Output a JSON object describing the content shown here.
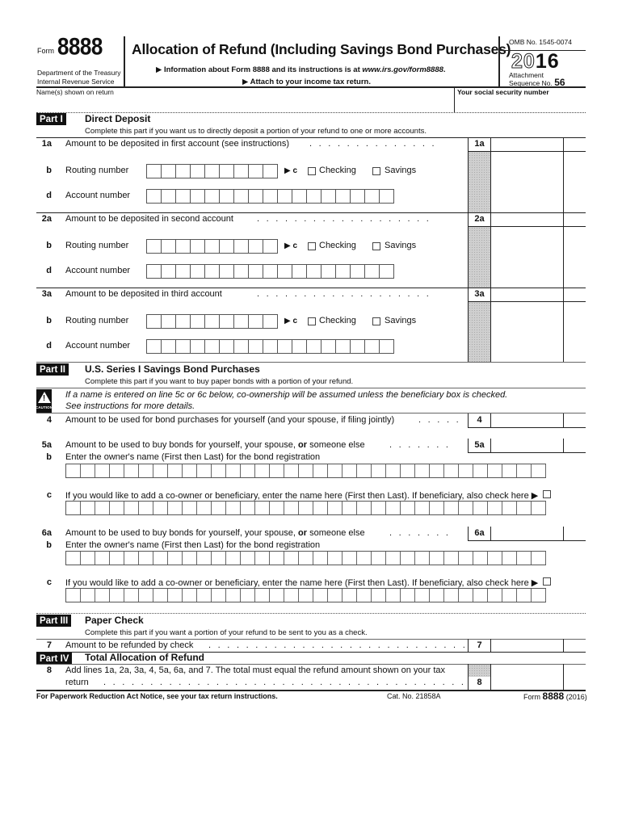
{
  "header": {
    "form_word": "Form",
    "form_number": "8888",
    "department": "Department of the Treasury",
    "agency": "Internal Revenue Service",
    "title": "Allocation of Refund (Including Savings Bond Purchases)",
    "info_prefix": "▶ Information about Form 8888 and its instructions is at ",
    "info_url": "www.irs.gov/form8888",
    "info_suffix": ".",
    "attach": "▶ Attach to your income tax return.",
    "omb": "OMB No. 1545-0074",
    "year_outline": "20",
    "year_bold": "16",
    "attachment_label": "Attachment",
    "sequence_label": "Sequence No.",
    "sequence_number": "56",
    "name_label": "Name(s) shown on return",
    "ssn_label": "Your social security number",
    "name_value": "",
    "ssn_value": ""
  },
  "part1": {
    "tag": "Part I",
    "title": "Direct Deposit",
    "instruction": "Complete this part if you want us to directly deposit a portion of your refund to one or more accounts.",
    "accounts": [
      {
        "num": "1a",
        "text": "Amount to be deposited in first account (see instructions)",
        "box": "1a",
        "amount": "",
        "cents": ""
      },
      {
        "num": "2a",
        "text": "Amount to be deposited in second account",
        "box": "2a",
        "amount": "",
        "cents": ""
      },
      {
        "num": "3a",
        "text": "Amount to be deposited in third account",
        "box": "3a",
        "amount": "",
        "cents": ""
      }
    ],
    "routing_letter": "b",
    "routing_label": "Routing number",
    "type_letter": "▶ c",
    "checking_label": "Checking",
    "savings_label": "Savings",
    "account_letter": "d",
    "account_label": "Account number",
    "routing_digits": 9,
    "account_digits": 17
  },
  "part2": {
    "tag": "Part II",
    "title": "U.S. Series I Savings Bond Purchases",
    "instruction": "Complete this part if you want to buy paper bonds with a portion of your refund.",
    "caution_label": "CAUTION",
    "caution_line1": "If a name is entered on line 5c or 6c below, co-ownership will be assumed unless the beneficiary box is checked.",
    "caution_line2": "See instructions for more details.",
    "line4": {
      "num": "4",
      "text": "Amount to be used for bond purchases for yourself (and your spouse, if filing jointly)",
      "box": "4"
    },
    "line5a": {
      "num": "5a",
      "text_pre": "Amount to be used to buy bonds for yourself, your spouse, ",
      "text_bold": "or",
      "text_post": " someone else",
      "box": "5a"
    },
    "line5b": {
      "num": "b",
      "text": "Enter the owner's name (First then Last) for the bond registration"
    },
    "line5c": {
      "num": "c",
      "text": "If you would like to add a co-owner or beneficiary, enter the name here (First then Last). If beneficiary, also check here ▶"
    },
    "line6a": {
      "num": "6a",
      "text_pre": "Amount to be used to buy bonds for yourself, your spouse, ",
      "text_bold": "or",
      "text_post": " someone else",
      "box": "6a"
    },
    "line6b": {
      "num": "b",
      "text": "Enter the owner's name (First then Last) for the bond registration"
    },
    "line6c": {
      "num": "c",
      "text": "If you would like to add a co-owner or beneficiary, enter the name here (First then Last). If beneficiary, also check here ▶"
    },
    "name_boxes": 33
  },
  "part3": {
    "tag": "Part III",
    "title": "Paper Check",
    "instruction": "Complete this part if you want a portion of your refund to be sent to you as a check.",
    "line7": {
      "num": "7",
      "text": "Amount to be refunded by check",
      "box": "7"
    }
  },
  "part4": {
    "tag": "Part IV",
    "title": "Total Allocation of Refund",
    "line8": {
      "num": "8",
      "text1": "Add lines 1a, 2a, 3a, 4, 5a, 6a, and 7. The total must equal the refund amount shown on your tax",
      "text2": "return",
      "box": "8"
    }
  },
  "footer": {
    "notice": "For Paperwork Reduction Act Notice, see your tax return instructions.",
    "cat": "Cat. No. 21858A",
    "form_word": "Form",
    "form_number": "8888",
    "year": "(2016)"
  }
}
